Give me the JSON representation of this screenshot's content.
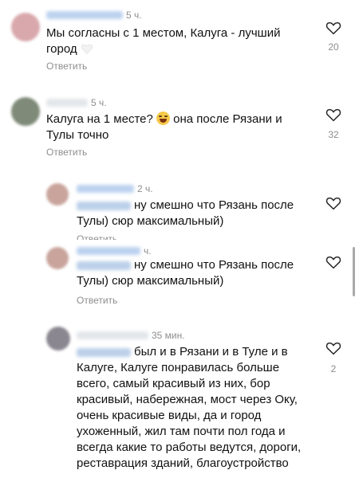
{
  "comments": [
    {
      "time": "5 ч.",
      "text": "Мы согласны с 1 местом, Калуга - лучший город",
      "reply_label": "Ответить",
      "likes": "20",
      "avatar_color": "#d9a8ac"
    },
    {
      "time": "5 ч.",
      "text_part1": "Калуга на 1 месте?",
      "emoji": "laughing-face-emoji",
      "text_part2": "она после Рязани и Тулы точно",
      "reply_label": "Ответить",
      "likes": "32",
      "avatar_color": "#7f8a78"
    },
    {
      "time": "2 ч.",
      "text": "ну смешно что Рязань после Тулы) сюр максимальный)",
      "reply_label": "Ответить",
      "avatar_color": "#c9a49c"
    },
    {
      "time": "ч.",
      "text": "ну смешно что Рязань после Тулы) сюр максимальный)",
      "reply_label": "Ответить",
      "avatar_color": "#c9a49c"
    },
    {
      "time": "35 мин.",
      "text": "был и в Рязани и в Туле и в Калуге, Калуге понравилась больше всего, самый красивый из них, бор красивый, набережная, мост через Оку, очень красивые виды, да и город ухоженный, жил там почти пол года и всегда какие то работы ведутся, дороги, реставрация зданий, благоустройство",
      "likes": "2",
      "avatar_color": "#8a8790"
    }
  ],
  "icons": {
    "like": "heart-outline-icon",
    "emoji_white_heart": "white-heart-emoji"
  },
  "colors": {
    "secondary_text": "#8e8e8e",
    "mention_blur": "#bcd0ea"
  }
}
